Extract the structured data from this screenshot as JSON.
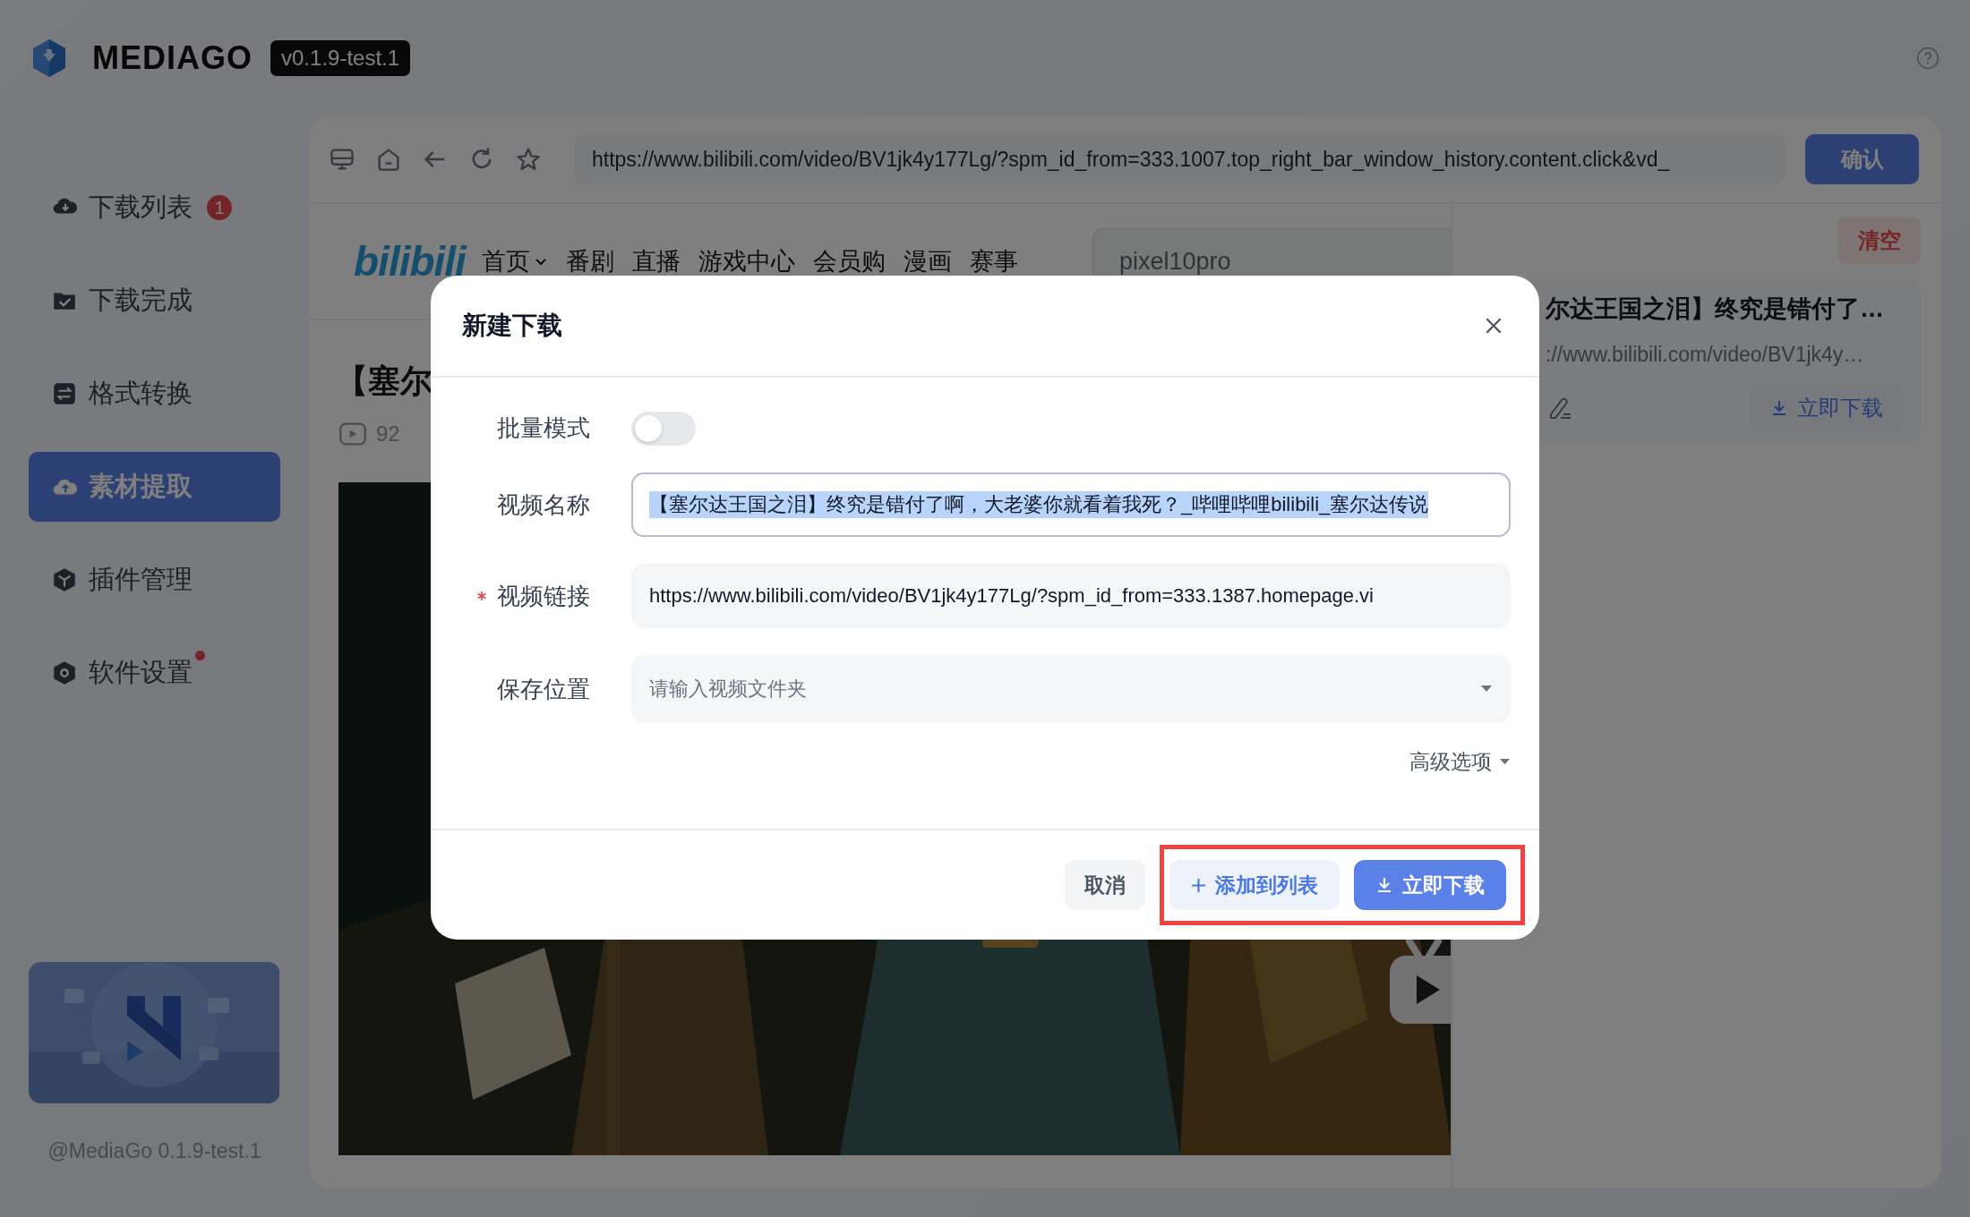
{
  "app": {
    "name": "MEDIAGO",
    "version": "v0.1.9-test.1"
  },
  "sidebar": {
    "items": [
      {
        "label": "下载列表",
        "badge": "1",
        "dot": false,
        "selected": false
      },
      {
        "label": "下载完成",
        "dot": false,
        "selected": false
      },
      {
        "label": "格式转换",
        "dot": false,
        "selected": false
      },
      {
        "label": "素材提取",
        "dot": false,
        "selected": true
      },
      {
        "label": "插件管理",
        "dot": false,
        "selected": false
      },
      {
        "label": "软件设置",
        "dot": true,
        "selected": false
      }
    ],
    "footer": "@MediaGo 0.1.9-test.1"
  },
  "browser": {
    "url": "https://www.bilibili.com/video/BV1jk4y177Lg/?spm_id_from=333.1007.top_right_bar_window_history.content.click&vd_",
    "confirm": "确认",
    "site": {
      "logo": "bilibili",
      "nav": [
        {
          "label": "首页",
          "dropdown": true
        },
        {
          "label": "番剧",
          "dropdown": false
        },
        {
          "label": "直播",
          "dropdown": false
        },
        {
          "label": "游戏中心",
          "dropdown": false
        },
        {
          "label": "会员购",
          "dropdown": false
        },
        {
          "label": "漫画",
          "dropdown": false
        },
        {
          "label": "赛事",
          "dropdown": false
        }
      ],
      "search": "pixel10pro"
    },
    "video_title": "【塞尔",
    "views": "92"
  },
  "download_panel": {
    "clear": "清空",
    "items": [
      {
        "title": "尔达王国之泪】终究是错付了…",
        "url": "://www.bilibili.com/video/BV1jk4y…",
        "action": "立即下载"
      }
    ]
  },
  "dialog": {
    "title": "新建下载",
    "fields": [
      {
        "kind": "switch",
        "label": "批量模式",
        "on": false,
        "required": false
      },
      {
        "kind": "text",
        "label": "视频名称",
        "value": "【塞尔达王国之泪】终究是错付了啊，大老婆你就看着我死？_哔哩哔哩bilibili_塞尔达传说",
        "focused": true,
        "text_selected": true,
        "required": false
      },
      {
        "kind": "text",
        "label": "视频链接",
        "value": "https://www.bilibili.com/video/BV1jk4y177Lg/?spm_id_from=333.1387.homepage.vi",
        "focused": false,
        "text_selected": false,
        "required": true
      },
      {
        "kind": "select",
        "label": "保存位置",
        "placeholder": "请输入视频文件夹",
        "required": false
      }
    ],
    "advanced": "高级选项",
    "buttons": [
      {
        "kind": "cancel",
        "label": "取消"
      },
      {
        "kind": "secondary",
        "label": "添加到列表"
      },
      {
        "kind": "primary",
        "label": "立即下载"
      }
    ],
    "highlight_actions": true
  }
}
